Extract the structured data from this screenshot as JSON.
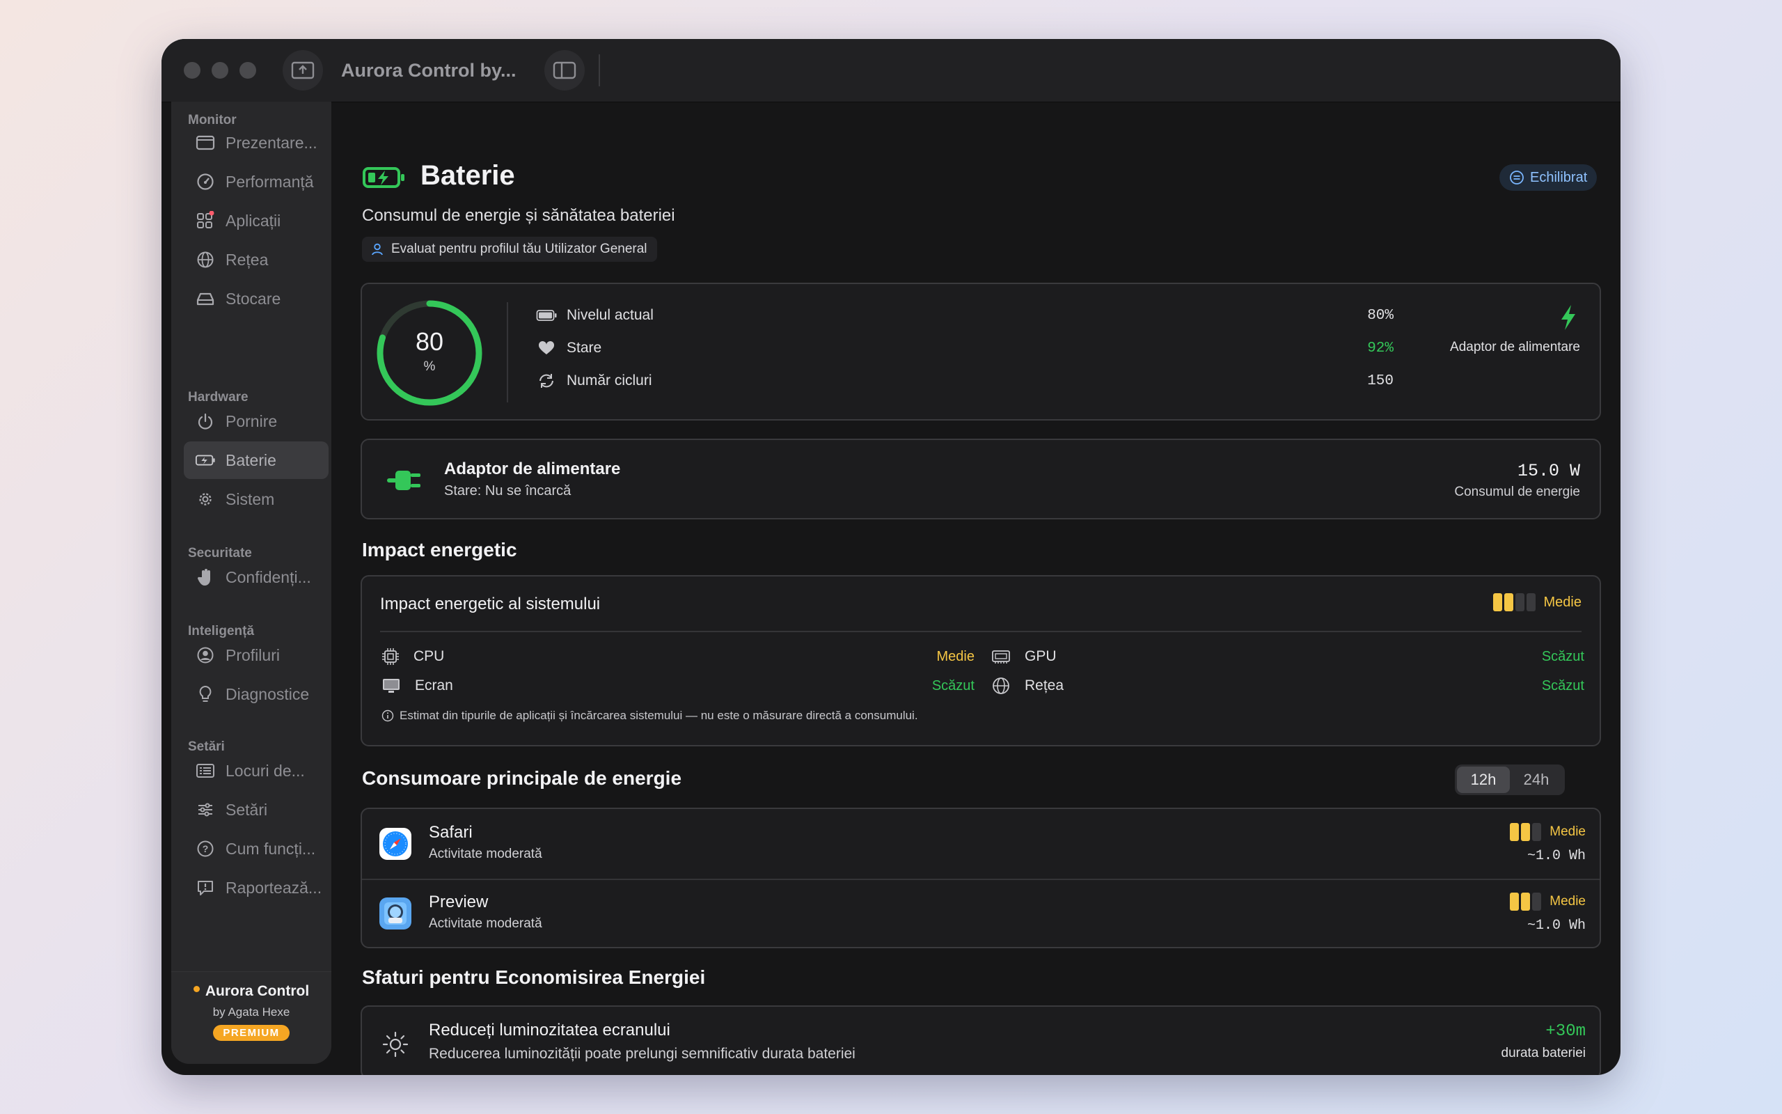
{
  "window": {
    "title": "Aurora Control by..."
  },
  "sidebar": {
    "sections": [
      {
        "label": "Monitor",
        "items": [
          {
            "label": "Prezentare...",
            "icon": "window-icon"
          },
          {
            "label": "Performanță",
            "icon": "gauge-icon"
          },
          {
            "label": "Aplicații",
            "icon": "apps-grid-icon"
          },
          {
            "label": "Rețea",
            "icon": "globe-icon"
          },
          {
            "label": "Stocare",
            "icon": "drive-icon"
          }
        ]
      },
      {
        "label": "Hardware",
        "items": [
          {
            "label": "Pornire",
            "icon": "power-icon"
          },
          {
            "label": "Baterie",
            "icon": "battery-charging-icon"
          },
          {
            "label": "Sistem",
            "icon": "gear-icon"
          }
        ]
      },
      {
        "label": "Securitate",
        "items": [
          {
            "label": "Confidenți...",
            "icon": "hand-icon"
          }
        ]
      },
      {
        "label": "Inteligență",
        "items": [
          {
            "label": "Profiluri",
            "icon": "person-circle-icon"
          },
          {
            "label": "Diagnostice",
            "icon": "lightbulb-icon"
          }
        ]
      },
      {
        "label": "Setări",
        "items": [
          {
            "label": "Locuri de...",
            "icon": "list-icon"
          },
          {
            "label": "Setări",
            "icon": "sliders-icon"
          },
          {
            "label": "Cum funcți...",
            "icon": "question-icon"
          },
          {
            "label": "Raportează...",
            "icon": "feedback-icon"
          }
        ]
      }
    ],
    "active": "Baterie",
    "footer": {
      "brand": "Aurora Control",
      "by": "by Agata Hexe",
      "badge": "PREMIUM"
    }
  },
  "header": {
    "title": "Baterie",
    "subtitle": "Consumul de energie și sănătatea bateriei",
    "profile_chip": "Evaluat pentru profilul tău Utilizator General",
    "mode_badge": "Echilibrat"
  },
  "battery": {
    "level": "80",
    "level_unit": "%",
    "level_fraction": 0.8,
    "rows": [
      {
        "label": "Nivelul actual",
        "value": "80%",
        "icon": "battery-icon"
      },
      {
        "label": "Stare",
        "value": "92%",
        "icon": "heart-icon"
      },
      {
        "label": "Număr cicluri",
        "value": "150",
        "icon": "cycle-icon"
      }
    ],
    "power_source": "Adaptor de alimentare"
  },
  "adapter": {
    "title": "Adaptor de alimentare",
    "status": "Stare: Nu se încarcă",
    "power": "15.0 W",
    "power_label": "Consumul de energie"
  },
  "impact": {
    "section_title": "Impact energetic",
    "card_title": "Impact energetic al sistemului",
    "overall": "Medie",
    "overall_bars": 2,
    "components": [
      {
        "label": "CPU",
        "value": "Medie",
        "icon": "cpu-icon"
      },
      {
        "label": "GPU",
        "value": "Scăzut",
        "icon": "gpu-icon"
      },
      {
        "label": "Ecran",
        "value": "Scăzut",
        "icon": "display-icon"
      },
      {
        "label": "Rețea",
        "value": "Scăzut",
        "icon": "globe-icon"
      }
    ],
    "note": "Estimat din tipurile de aplicații și încărcarea sistemului — nu este o măsurare directă a consumului."
  },
  "consumers": {
    "section_title": "Consumoare principale de energie",
    "tabs": [
      "12h",
      "24h"
    ],
    "selected_tab": "12h",
    "apps": [
      {
        "name": "Safari",
        "activity": "Activitate moderată",
        "impact": "Medie",
        "bars": 2,
        "energy": "~1.0 Wh",
        "icon": "safari-icon"
      },
      {
        "name": "Preview",
        "activity": "Activitate moderată",
        "impact": "Medie",
        "bars": 2,
        "energy": "~1.0 Wh",
        "icon": "preview-icon"
      }
    ]
  },
  "tips": {
    "section_title": "Sfaturi pentru Economisirea Energiei",
    "items": [
      {
        "title": "Reduceți luminozitatea ecranului",
        "desc": "Reducerea luminozității poate prelungi semnificativ durata bateriei",
        "gain": "+30m",
        "gain_label": "durata bateriei",
        "icon": "sun-icon"
      }
    ]
  },
  "colors": {
    "accent_green": "#34c759",
    "accent_yellow": "#f5c644",
    "premium": "#f5a623",
    "background": "#161617"
  }
}
